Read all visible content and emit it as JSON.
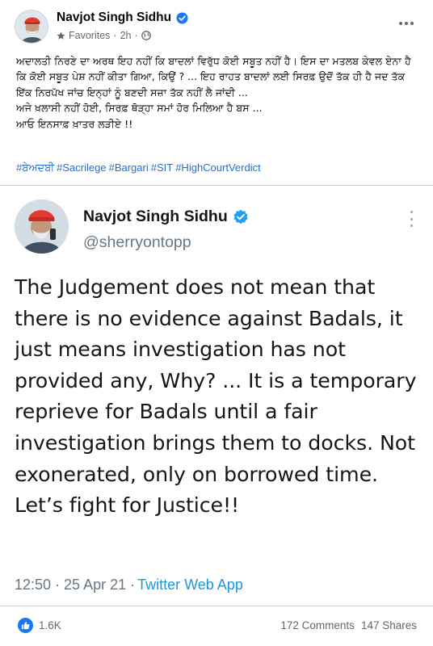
{
  "post": {
    "author": "Navjot Singh Sidhu",
    "audience": "Favorites",
    "time": "2h",
    "body_lines": [
      "ਅਦਾਲਤੀ ਨਿਰਣੇ ਦਾ ਅਰਥ ਇਹ ਨਹੀਂ ਕਿ ਬਾਦਲਾਂ ਵਿਰੁੱਧ ਕੋਈ ਸਬੂਤ ਨਹੀਂ ਹੈ। ਇਸ ਦਾ ਮਤਲਬ ਕੇਵਲ ਏਨਾ ਹੈ ਕਿ ਕੋਈ ਸਬੂਤ ਪੇਸ਼ ਨਹੀਂ ਕੀਤਾ ਗਿਆ, ਕਿਉਂ ? ... ਇਹ ਰਾਹਤ ਬਾਦਲਾਂ ਲਈ ਸਿਰਫ਼ ਉਦੋਂ ਤੱਕ ਹੀ ਹੈ ਜਦ ਤੱਕ ਇੱਕ ਨਿਰਪੱਖ ਜਾਂਚ ਇਨ੍ਹਾਂ ਨੂੰ ਬਣਦੀ ਸਜ਼ਾ ਤੱਕ ਨਹੀਂ ਲੈ ਜਾਂਦੀ ...",
      "ਅਜੇ ਖ਼ਲਾਸੀ ਨਹੀਂ ਹੋਈ, ਸਿਰਫ਼ ਥੋੜ੍ਹਾ ਸਮਾਂ ਹੋਰ ਮਿਲਿਆ ਹੈ ਬਸ ...",
      "ਆਓ ਇਨਸਾਫ਼ ਖ਼ਾਤਰ ਲੜੀਏ !!"
    ],
    "hashtags": [
      "#ਬੇਅਦਬੀ",
      "#Sacrilege",
      "#Bargari",
      "#SIT",
      "#HighCourtVerdict"
    ]
  },
  "tweet": {
    "name": "Navjot Singh Sidhu",
    "handle": "@sherryontopp",
    "text": "The Judgement does not mean that there is no evidence against Badals, it just means investigation has not provided any, Why? ... It is a temporary reprieve for Badals until a fair investigation brings them to docks. Not exonerated, only on borrowed time. Let’s fight for Justice!!",
    "timestamp": "12:50 · 25 Apr 21 ·",
    "app": "Twitter Web App"
  },
  "reactions": {
    "likes": "1.6K",
    "comments": "172 Comments",
    "shares": "147 Shares"
  },
  "colors": {
    "link": "#216fdb",
    "verified": "#1877f2",
    "tweet_verified": "#1da1f2",
    "meta": "#65676b"
  },
  "icons": [
    "verified-badge-icon",
    "star-icon",
    "globe-icon",
    "more-options-icon",
    "like-reaction-icon"
  ]
}
